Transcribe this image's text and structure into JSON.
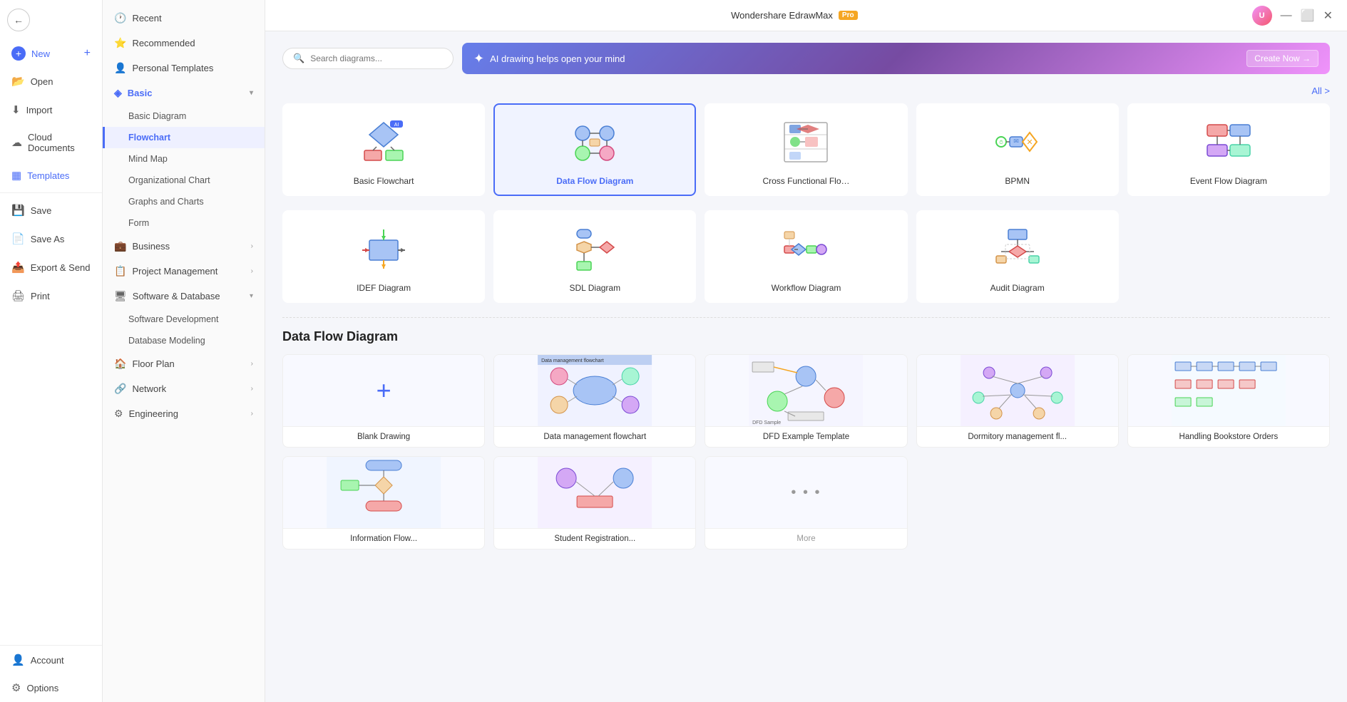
{
  "app": {
    "title": "Wondershare EdrawMax",
    "badge": "Pro"
  },
  "main_nav": {
    "back_label": "←",
    "items": [
      {
        "id": "new",
        "label": "New",
        "icon": "⊕",
        "active": false,
        "plus": true
      },
      {
        "id": "open",
        "label": "Open",
        "icon": "📂",
        "active": false
      },
      {
        "id": "import",
        "label": "Import",
        "icon": "⬇",
        "active": false
      },
      {
        "id": "cloud",
        "label": "Cloud Documents",
        "icon": "☁",
        "active": false
      },
      {
        "id": "templates",
        "label": "Templates",
        "icon": "▦",
        "active": true
      }
    ],
    "bottom_items": [
      {
        "id": "save",
        "label": "Save",
        "icon": "💾"
      },
      {
        "id": "saveas",
        "label": "Save As",
        "icon": "📄"
      },
      {
        "id": "export",
        "label": "Export & Send",
        "icon": "📤"
      },
      {
        "id": "print",
        "label": "Print",
        "icon": "🖨"
      }
    ],
    "footer_items": [
      {
        "id": "account",
        "label": "Account",
        "icon": "👤"
      },
      {
        "id": "options",
        "label": "Options",
        "icon": "⚙"
      }
    ]
  },
  "secondary_nav": {
    "items": [
      {
        "id": "recent",
        "label": "Recent",
        "icon": "🕐",
        "expandable": false
      },
      {
        "id": "recommended",
        "label": "Recommended",
        "icon": "⭐",
        "expandable": false
      },
      {
        "id": "personal",
        "label": "Personal Templates",
        "icon": "👤",
        "expandable": false
      },
      {
        "id": "basic",
        "label": "Basic",
        "icon": "◈",
        "expandable": true,
        "expanded": true,
        "children": [
          {
            "id": "basic-diagram",
            "label": "Basic Diagram"
          },
          {
            "id": "flowchart",
            "label": "Flowchart",
            "active": true
          },
          {
            "id": "mind-map",
            "label": "Mind Map"
          },
          {
            "id": "org-chart",
            "label": "Organizational Chart"
          },
          {
            "id": "graphs",
            "label": "Graphs and Charts"
          },
          {
            "id": "form",
            "label": "Form"
          }
        ]
      },
      {
        "id": "business",
        "label": "Business",
        "icon": "💼",
        "expandable": true
      },
      {
        "id": "project",
        "label": "Project Management",
        "icon": "📋",
        "expandable": true
      },
      {
        "id": "software",
        "label": "Software & Database",
        "icon": "🖥",
        "expandable": true,
        "expanded": true,
        "children": [
          {
            "id": "sw-dev",
            "label": "Software Development"
          },
          {
            "id": "db-model",
            "label": "Database Modeling"
          }
        ]
      },
      {
        "id": "floorplan",
        "label": "Floor Plan",
        "icon": "🏠",
        "expandable": true
      },
      {
        "id": "network",
        "label": "Network",
        "icon": "🔗",
        "expandable": true
      },
      {
        "id": "engineering",
        "label": "Engineering",
        "icon": "⚙",
        "expandable": true
      }
    ]
  },
  "search": {
    "placeholder": "Search diagrams..."
  },
  "ai_banner": {
    "icon": "✦",
    "text": "AI drawing helps open your mind",
    "button": "Create Now →"
  },
  "all_link": "All >",
  "diagram_types": [
    {
      "id": "basic-flowchart",
      "label": "Basic Flowchart",
      "selected": false
    },
    {
      "id": "data-flow",
      "label": "Data Flow Diagram",
      "selected": true
    },
    {
      "id": "cross-functional",
      "label": "Cross Functional Flo…",
      "selected": false
    },
    {
      "id": "bpmn",
      "label": "BPMN",
      "selected": false
    },
    {
      "id": "event-flow",
      "label": "Event Flow Diagram",
      "selected": false
    },
    {
      "id": "idef",
      "label": "IDEF Diagram",
      "selected": false
    },
    {
      "id": "sdl",
      "label": "SDL Diagram",
      "selected": false
    },
    {
      "id": "workflow",
      "label": "Workflow Diagram",
      "selected": false
    },
    {
      "id": "audit",
      "label": "Audit Diagram",
      "selected": false
    }
  ],
  "section_title": "Data Flow Diagram",
  "templates": [
    {
      "id": "blank",
      "label": "Blank Drawing",
      "type": "blank"
    },
    {
      "id": "data-mgmt",
      "label": "Data management flowchart",
      "type": "preview"
    },
    {
      "id": "dfd-example",
      "label": "DFD Example Template",
      "type": "preview"
    },
    {
      "id": "dormitory",
      "label": "Dormitory management fl...",
      "type": "preview"
    },
    {
      "id": "bookstore",
      "label": "Handling Bookstore Orders",
      "type": "preview"
    },
    {
      "id": "info-flow",
      "label": "Information Flow...",
      "type": "preview"
    },
    {
      "id": "student-reg",
      "label": "Student Registration...",
      "type": "preview"
    },
    {
      "id": "more",
      "label": "...",
      "type": "more"
    }
  ],
  "title_icons": [
    "?",
    "🔔",
    "⋯",
    "⬆",
    "⋯"
  ],
  "avatar_initials": "U"
}
